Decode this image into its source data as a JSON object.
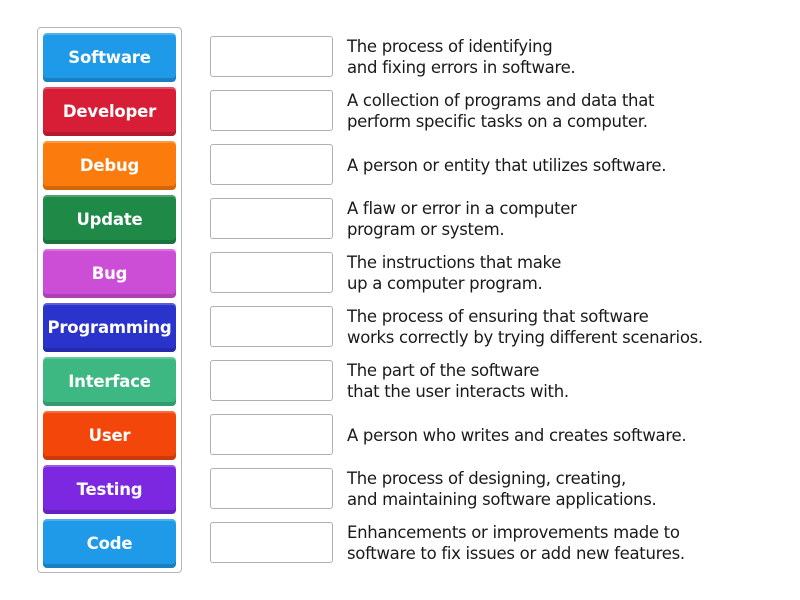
{
  "terms": [
    {
      "label": "Software",
      "color": "#1e9ae8"
    },
    {
      "label": "Developer",
      "color": "#d81e36"
    },
    {
      "label": "Debug",
      "color": "#fb7b0c"
    },
    {
      "label": "Update",
      "color": "#1f8a48"
    },
    {
      "label": "Bug",
      "color": "#cc4ed6"
    },
    {
      "label": "Programming",
      "color": "#2a33cc"
    },
    {
      "label": "Interface",
      "color": "#3db882"
    },
    {
      "label": "User",
      "color": "#f2460a"
    },
    {
      "label": "Testing",
      "color": "#7b28e0"
    },
    {
      "label": "Code",
      "color": "#1e9ae8"
    }
  ],
  "definitions": [
    {
      "text": "The process of identifying\nand fixing errors in software.",
      "answer": ""
    },
    {
      "text": "A collection of programs and data that\nperform specific tasks on a computer.",
      "answer": ""
    },
    {
      "text": "A person or entity that utilizes software.",
      "answer": ""
    },
    {
      "text": "A flaw or error in a computer\nprogram or system.",
      "answer": ""
    },
    {
      "text": "The instructions that make\nup a computer program.",
      "answer": ""
    },
    {
      "text": "The process of ensuring that software\nworks correctly by trying different scenarios.",
      "answer": ""
    },
    {
      "text": "The part of the software\nthat the user interacts with.",
      "answer": ""
    },
    {
      "text": "A person who writes and creates software.",
      "answer": ""
    },
    {
      "text": "The process of designing, creating,\nand maintaining software applications.",
      "answer": ""
    },
    {
      "text": "Enhancements or improvements made to\nsoftware to fix issues or add new features.",
      "answer": ""
    }
  ]
}
